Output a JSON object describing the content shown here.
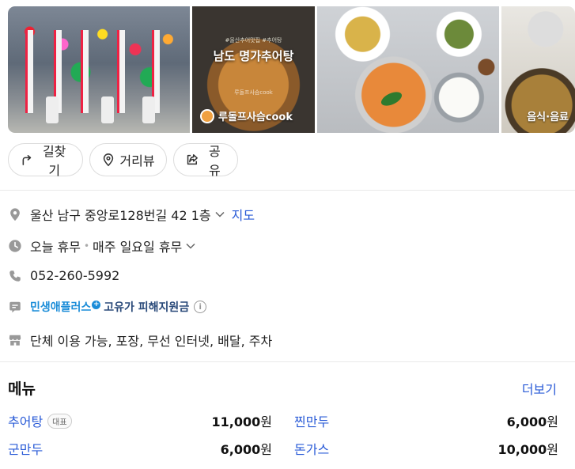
{
  "photos": {
    "photo2": {
      "top_caption": "#울산추어맛집 #추어탕",
      "title": "남도 명가추어탕",
      "watermark": "루돌프사슴cook",
      "credit": "루돌프사슴cook"
    },
    "photo4": {
      "category": "음식·음료"
    }
  },
  "actions": {
    "directions": "길찾기",
    "street_view": "거리뷰",
    "share": "공유"
  },
  "info": {
    "address": "울산 남구 중앙로128번길 42 1층",
    "map_link": "지도",
    "hours_status": "오늘 휴무",
    "hours_detail": "매주 일요일 휴무",
    "phone": "052-260-5992",
    "promo_brand": "민생애플러스",
    "promo_plus": "+",
    "promo_text": "고유가 피해지원금",
    "info_mark": "i",
    "amenities": "단체 이용 가능, 포장, 무선 인터넷, 배달, 주차"
  },
  "menu": {
    "title": "메뉴",
    "more": "더보기",
    "items": [
      {
        "name": "추어탕",
        "tag": "대표",
        "price": "11,000",
        "unit": "원"
      },
      {
        "name": "찐만두",
        "price": "6,000",
        "unit": "원"
      },
      {
        "name": "군만두",
        "price": "6,000",
        "unit": "원"
      },
      {
        "name": "돈가스",
        "price": "10,000",
        "unit": "원"
      }
    ]
  }
}
